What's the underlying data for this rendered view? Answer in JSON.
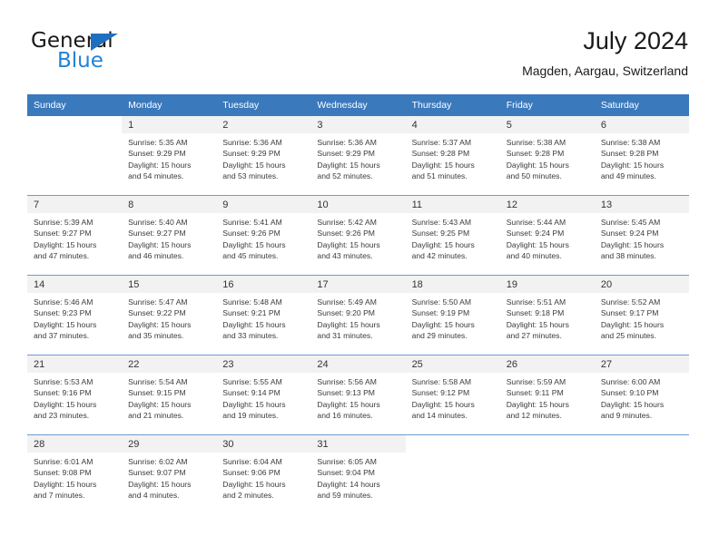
{
  "logo": {
    "word_one": "General",
    "word_two": "Blue",
    "triangle_icon": "triangle-icon",
    "brand_blue": "#2183d6",
    "triangle_blue": "#1f6fc0"
  },
  "header": {
    "title": "July 2024",
    "subtitle": "Magden, Aargau, Switzerland"
  },
  "calendar": {
    "header_bg": "#3b79bd",
    "daynum_bg": "#f2f2f2",
    "weekday_headers": [
      "Sunday",
      "Monday",
      "Tuesday",
      "Wednesday",
      "Thursday",
      "Friday",
      "Saturday"
    ],
    "weeks": [
      {
        "days": [
          {
            "num": "",
            "sunrise": "",
            "sunset": "",
            "daylight_1": "",
            "daylight_2": "",
            "empty": true
          },
          {
            "num": "1",
            "sunrise": "Sunrise: 5:35 AM",
            "sunset": "Sunset: 9:29 PM",
            "daylight_1": "Daylight: 15 hours",
            "daylight_2": "and 54 minutes."
          },
          {
            "num": "2",
            "sunrise": "Sunrise: 5:36 AM",
            "sunset": "Sunset: 9:29 PM",
            "daylight_1": "Daylight: 15 hours",
            "daylight_2": "and 53 minutes."
          },
          {
            "num": "3",
            "sunrise": "Sunrise: 5:36 AM",
            "sunset": "Sunset: 9:29 PM",
            "daylight_1": "Daylight: 15 hours",
            "daylight_2": "and 52 minutes."
          },
          {
            "num": "4",
            "sunrise": "Sunrise: 5:37 AM",
            "sunset": "Sunset: 9:28 PM",
            "daylight_1": "Daylight: 15 hours",
            "daylight_2": "and 51 minutes."
          },
          {
            "num": "5",
            "sunrise": "Sunrise: 5:38 AM",
            "sunset": "Sunset: 9:28 PM",
            "daylight_1": "Daylight: 15 hours",
            "daylight_2": "and 50 minutes."
          },
          {
            "num": "6",
            "sunrise": "Sunrise: 5:38 AM",
            "sunset": "Sunset: 9:28 PM",
            "daylight_1": "Daylight: 15 hours",
            "daylight_2": "and 49 minutes."
          }
        ]
      },
      {
        "days": [
          {
            "num": "7",
            "sunrise": "Sunrise: 5:39 AM",
            "sunset": "Sunset: 9:27 PM",
            "daylight_1": "Daylight: 15 hours",
            "daylight_2": "and 47 minutes."
          },
          {
            "num": "8",
            "sunrise": "Sunrise: 5:40 AM",
            "sunset": "Sunset: 9:27 PM",
            "daylight_1": "Daylight: 15 hours",
            "daylight_2": "and 46 minutes."
          },
          {
            "num": "9",
            "sunrise": "Sunrise: 5:41 AM",
            "sunset": "Sunset: 9:26 PM",
            "daylight_1": "Daylight: 15 hours",
            "daylight_2": "and 45 minutes."
          },
          {
            "num": "10",
            "sunrise": "Sunrise: 5:42 AM",
            "sunset": "Sunset: 9:26 PM",
            "daylight_1": "Daylight: 15 hours",
            "daylight_2": "and 43 minutes."
          },
          {
            "num": "11",
            "sunrise": "Sunrise: 5:43 AM",
            "sunset": "Sunset: 9:25 PM",
            "daylight_1": "Daylight: 15 hours",
            "daylight_2": "and 42 minutes."
          },
          {
            "num": "12",
            "sunrise": "Sunrise: 5:44 AM",
            "sunset": "Sunset: 9:24 PM",
            "daylight_1": "Daylight: 15 hours",
            "daylight_2": "and 40 minutes."
          },
          {
            "num": "13",
            "sunrise": "Sunrise: 5:45 AM",
            "sunset": "Sunset: 9:24 PM",
            "daylight_1": "Daylight: 15 hours",
            "daylight_2": "and 38 minutes."
          }
        ]
      },
      {
        "days": [
          {
            "num": "14",
            "sunrise": "Sunrise: 5:46 AM",
            "sunset": "Sunset: 9:23 PM",
            "daylight_1": "Daylight: 15 hours",
            "daylight_2": "and 37 minutes."
          },
          {
            "num": "15",
            "sunrise": "Sunrise: 5:47 AM",
            "sunset": "Sunset: 9:22 PM",
            "daylight_1": "Daylight: 15 hours",
            "daylight_2": "and 35 minutes."
          },
          {
            "num": "16",
            "sunrise": "Sunrise: 5:48 AM",
            "sunset": "Sunset: 9:21 PM",
            "daylight_1": "Daylight: 15 hours",
            "daylight_2": "and 33 minutes."
          },
          {
            "num": "17",
            "sunrise": "Sunrise: 5:49 AM",
            "sunset": "Sunset: 9:20 PM",
            "daylight_1": "Daylight: 15 hours",
            "daylight_2": "and 31 minutes."
          },
          {
            "num": "18",
            "sunrise": "Sunrise: 5:50 AM",
            "sunset": "Sunset: 9:19 PM",
            "daylight_1": "Daylight: 15 hours",
            "daylight_2": "and 29 minutes."
          },
          {
            "num": "19",
            "sunrise": "Sunrise: 5:51 AM",
            "sunset": "Sunset: 9:18 PM",
            "daylight_1": "Daylight: 15 hours",
            "daylight_2": "and 27 minutes."
          },
          {
            "num": "20",
            "sunrise": "Sunrise: 5:52 AM",
            "sunset": "Sunset: 9:17 PM",
            "daylight_1": "Daylight: 15 hours",
            "daylight_2": "and 25 minutes."
          }
        ]
      },
      {
        "days": [
          {
            "num": "21",
            "sunrise": "Sunrise: 5:53 AM",
            "sunset": "Sunset: 9:16 PM",
            "daylight_1": "Daylight: 15 hours",
            "daylight_2": "and 23 minutes."
          },
          {
            "num": "22",
            "sunrise": "Sunrise: 5:54 AM",
            "sunset": "Sunset: 9:15 PM",
            "daylight_1": "Daylight: 15 hours",
            "daylight_2": "and 21 minutes."
          },
          {
            "num": "23",
            "sunrise": "Sunrise: 5:55 AM",
            "sunset": "Sunset: 9:14 PM",
            "daylight_1": "Daylight: 15 hours",
            "daylight_2": "and 19 minutes."
          },
          {
            "num": "24",
            "sunrise": "Sunrise: 5:56 AM",
            "sunset": "Sunset: 9:13 PM",
            "daylight_1": "Daylight: 15 hours",
            "daylight_2": "and 16 minutes."
          },
          {
            "num": "25",
            "sunrise": "Sunrise: 5:58 AM",
            "sunset": "Sunset: 9:12 PM",
            "daylight_1": "Daylight: 15 hours",
            "daylight_2": "and 14 minutes."
          },
          {
            "num": "26",
            "sunrise": "Sunrise: 5:59 AM",
            "sunset": "Sunset: 9:11 PM",
            "daylight_1": "Daylight: 15 hours",
            "daylight_2": "and 12 minutes."
          },
          {
            "num": "27",
            "sunrise": "Sunrise: 6:00 AM",
            "sunset": "Sunset: 9:10 PM",
            "daylight_1": "Daylight: 15 hours",
            "daylight_2": "and 9 minutes."
          }
        ]
      },
      {
        "days": [
          {
            "num": "28",
            "sunrise": "Sunrise: 6:01 AM",
            "sunset": "Sunset: 9:08 PM",
            "daylight_1": "Daylight: 15 hours",
            "daylight_2": "and 7 minutes."
          },
          {
            "num": "29",
            "sunrise": "Sunrise: 6:02 AM",
            "sunset": "Sunset: 9:07 PM",
            "daylight_1": "Daylight: 15 hours",
            "daylight_2": "and 4 minutes."
          },
          {
            "num": "30",
            "sunrise": "Sunrise: 6:04 AM",
            "sunset": "Sunset: 9:06 PM",
            "daylight_1": "Daylight: 15 hours",
            "daylight_2": "and 2 minutes."
          },
          {
            "num": "31",
            "sunrise": "Sunrise: 6:05 AM",
            "sunset": "Sunset: 9:04 PM",
            "daylight_1": "Daylight: 14 hours",
            "daylight_2": "and 59 minutes."
          },
          {
            "num": "",
            "sunrise": "",
            "sunset": "",
            "daylight_1": "",
            "daylight_2": "",
            "empty": true
          },
          {
            "num": "",
            "sunrise": "",
            "sunset": "",
            "daylight_1": "",
            "daylight_2": "",
            "empty": true
          },
          {
            "num": "",
            "sunrise": "",
            "sunset": "",
            "daylight_1": "",
            "daylight_2": "",
            "empty": true
          }
        ]
      }
    ]
  }
}
